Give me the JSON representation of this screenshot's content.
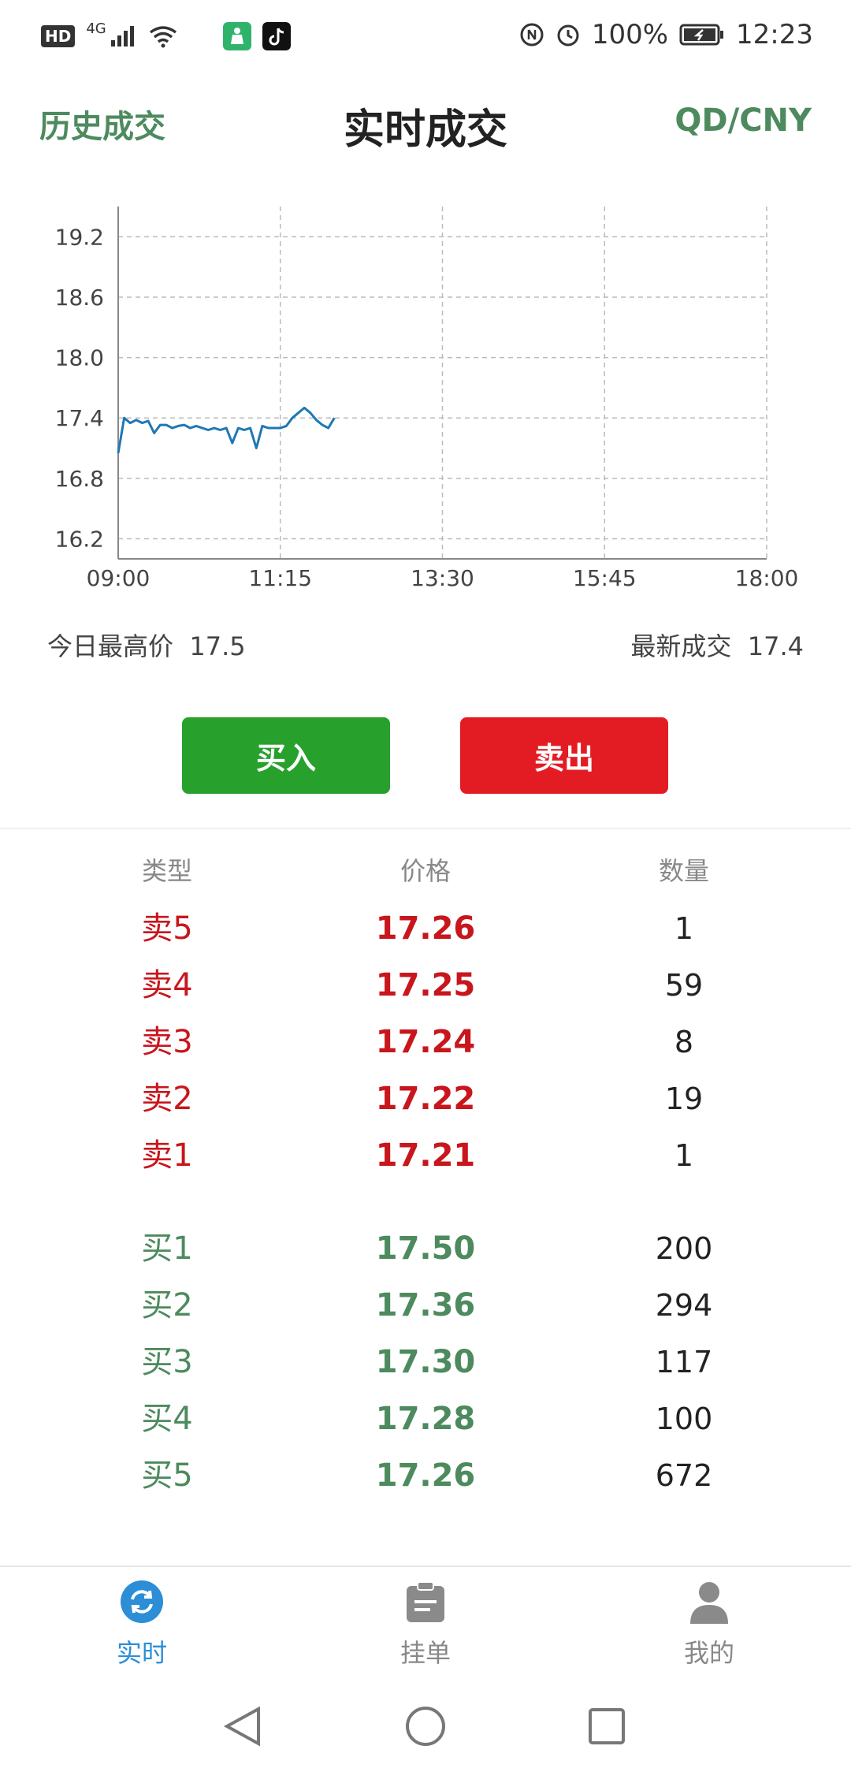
{
  "status_bar": {
    "hd": "HD",
    "network": "4G",
    "battery": "100%",
    "time": "12:23"
  },
  "header": {
    "left_link": "历史成交",
    "title": "实时成交",
    "right_link": "QD/CNY"
  },
  "chart_data": {
    "type": "line",
    "x": [
      "09:00",
      "09:05",
      "09:10",
      "09:15",
      "09:20",
      "09:25",
      "09:30",
      "09:35",
      "09:40",
      "09:45",
      "09:50",
      "09:55",
      "10:00",
      "10:05",
      "10:10",
      "10:15",
      "10:20",
      "10:25",
      "10:30",
      "10:35",
      "10:40",
      "10:45",
      "10:50",
      "10:55",
      "11:00",
      "11:05",
      "11:10",
      "11:15",
      "11:20",
      "11:25",
      "11:30",
      "11:35",
      "11:40",
      "11:45",
      "11:50",
      "11:55",
      "12:00"
    ],
    "values": [
      17.05,
      17.4,
      17.35,
      17.38,
      17.35,
      17.37,
      17.25,
      17.33,
      17.33,
      17.3,
      17.32,
      17.33,
      17.3,
      17.32,
      17.3,
      17.28,
      17.3,
      17.28,
      17.3,
      17.15,
      17.3,
      17.28,
      17.3,
      17.1,
      17.32,
      17.3,
      17.3,
      17.3,
      17.32,
      17.4,
      17.45,
      17.5,
      17.45,
      17.38,
      17.33,
      17.3,
      17.4
    ],
    "x_ticks": [
      "09:00",
      "11:15",
      "13:30",
      "15:45",
      "18:00"
    ],
    "y_ticks": [
      16.2,
      16.8,
      17.4,
      18.0,
      18.6,
      19.2
    ],
    "ylim": [
      16.0,
      19.5
    ],
    "x_range": [
      "09:00",
      "18:00"
    ],
    "grid": true,
    "line_color": "#1f77b4"
  },
  "stats": {
    "high_label": "今日最高价",
    "high_value": "17.5",
    "latest_label": "最新成交",
    "latest_value": "17.4"
  },
  "buttons": {
    "buy": "买入",
    "sell": "卖出"
  },
  "order_book": {
    "headers": [
      "类型",
      "价格",
      "数量"
    ],
    "asks": [
      {
        "type": "卖5",
        "price": "17.26",
        "qty": "1"
      },
      {
        "type": "卖4",
        "price": "17.25",
        "qty": "59"
      },
      {
        "type": "卖3",
        "price": "17.24",
        "qty": "8"
      },
      {
        "type": "卖2",
        "price": "17.22",
        "qty": "19"
      },
      {
        "type": "卖1",
        "price": "17.21",
        "qty": "1"
      }
    ],
    "bids": [
      {
        "type": "买1",
        "price": "17.50",
        "qty": "200"
      },
      {
        "type": "买2",
        "price": "17.36",
        "qty": "294"
      },
      {
        "type": "买3",
        "price": "17.30",
        "qty": "117"
      },
      {
        "type": "买4",
        "price": "17.28",
        "qty": "100"
      },
      {
        "type": "买5",
        "price": "17.26",
        "qty": "672"
      }
    ]
  },
  "tabs": [
    {
      "label": "实时",
      "icon": "refresh-icon",
      "active": true
    },
    {
      "label": "挂单",
      "icon": "clipboard-icon",
      "active": false
    },
    {
      "label": "我的",
      "icon": "person-icon",
      "active": false
    }
  ],
  "colors": {
    "accent_green": "#4d8a5e",
    "buy": "#27a02c",
    "sell": "#e31c24",
    "ask_text": "#c8161d",
    "tab_active": "#2b8ed6",
    "tab_inactive": "#888888"
  }
}
